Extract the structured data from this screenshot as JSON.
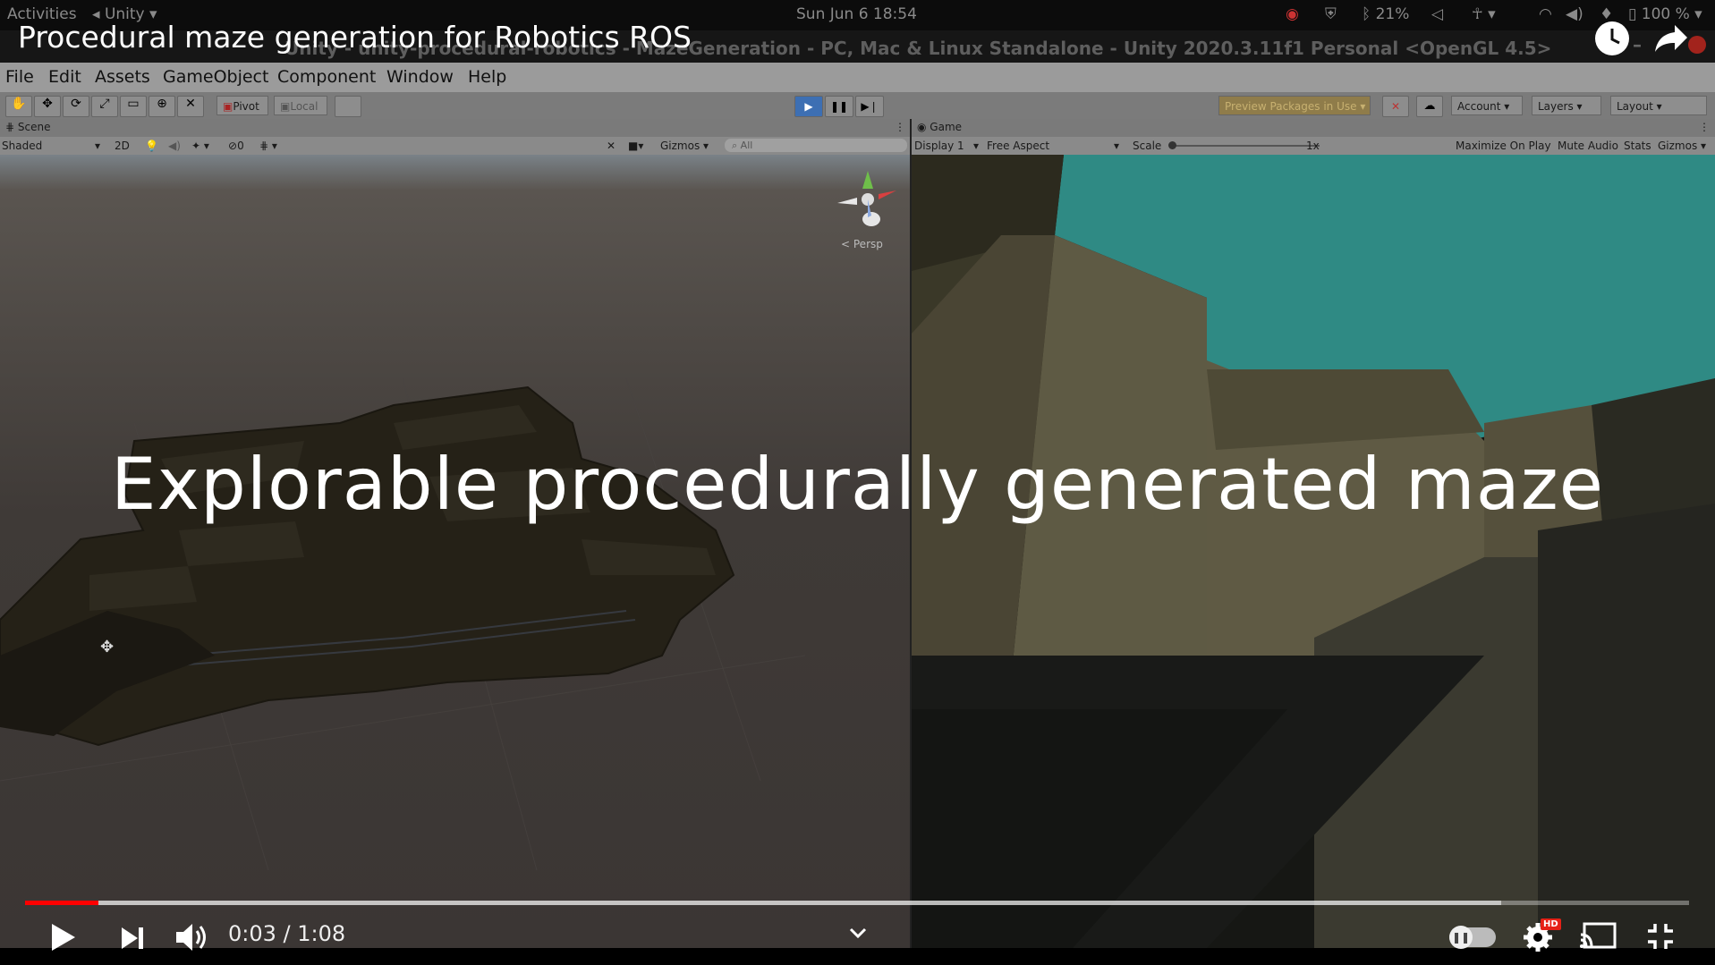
{
  "os_bar": {
    "activities": "Activities",
    "app": "Unity",
    "datetime": "Sun Jun 6  18:54",
    "battery_charge": "21%",
    "battery_main": "100 %"
  },
  "unity_title": "Unity - unity-procedural-robotics - MazeGeneration - PC, Mac & Linux Standalone - Unity 2020.3.11f1 Personal <OpenGL 4.5>",
  "video_title": "Procedural maze generation for Robotics ROS",
  "menu": [
    "File",
    "Edit",
    "Assets",
    "GameObject",
    "Component",
    "Window",
    "Help"
  ],
  "toolbar": {
    "pivot": "Pivot",
    "local": "Local",
    "preview_packages": "Preview Packages in Use",
    "account": "Account",
    "layers": "Layers",
    "layout": "Layout"
  },
  "scene_panel": {
    "tab": "Scene",
    "shading": "Shaded",
    "mode_2d": "2D",
    "hidden_count": "0",
    "gizmos": "Gizmos",
    "search_placeholder": "All",
    "persp": "Persp"
  },
  "game_panel": {
    "tab": "Game",
    "display": "Display 1",
    "aspect": "Free Aspect",
    "scale_label": "Scale",
    "scale_value": "1x",
    "maximize": "Maximize On Play",
    "mute": "Mute Audio",
    "stats": "Stats",
    "gizmos": "Gizmos"
  },
  "caption": "Explorable procedurally generated maze",
  "player": {
    "current_time": "0:03",
    "duration": "1:08",
    "time_display": "0:03 / 1:08",
    "progress_fraction": 0.044,
    "buffered_fraction": 0.887,
    "hd_badge": "HD",
    "colors": {
      "progress": "#ff0000",
      "hd_badge": "#e62117"
    }
  }
}
